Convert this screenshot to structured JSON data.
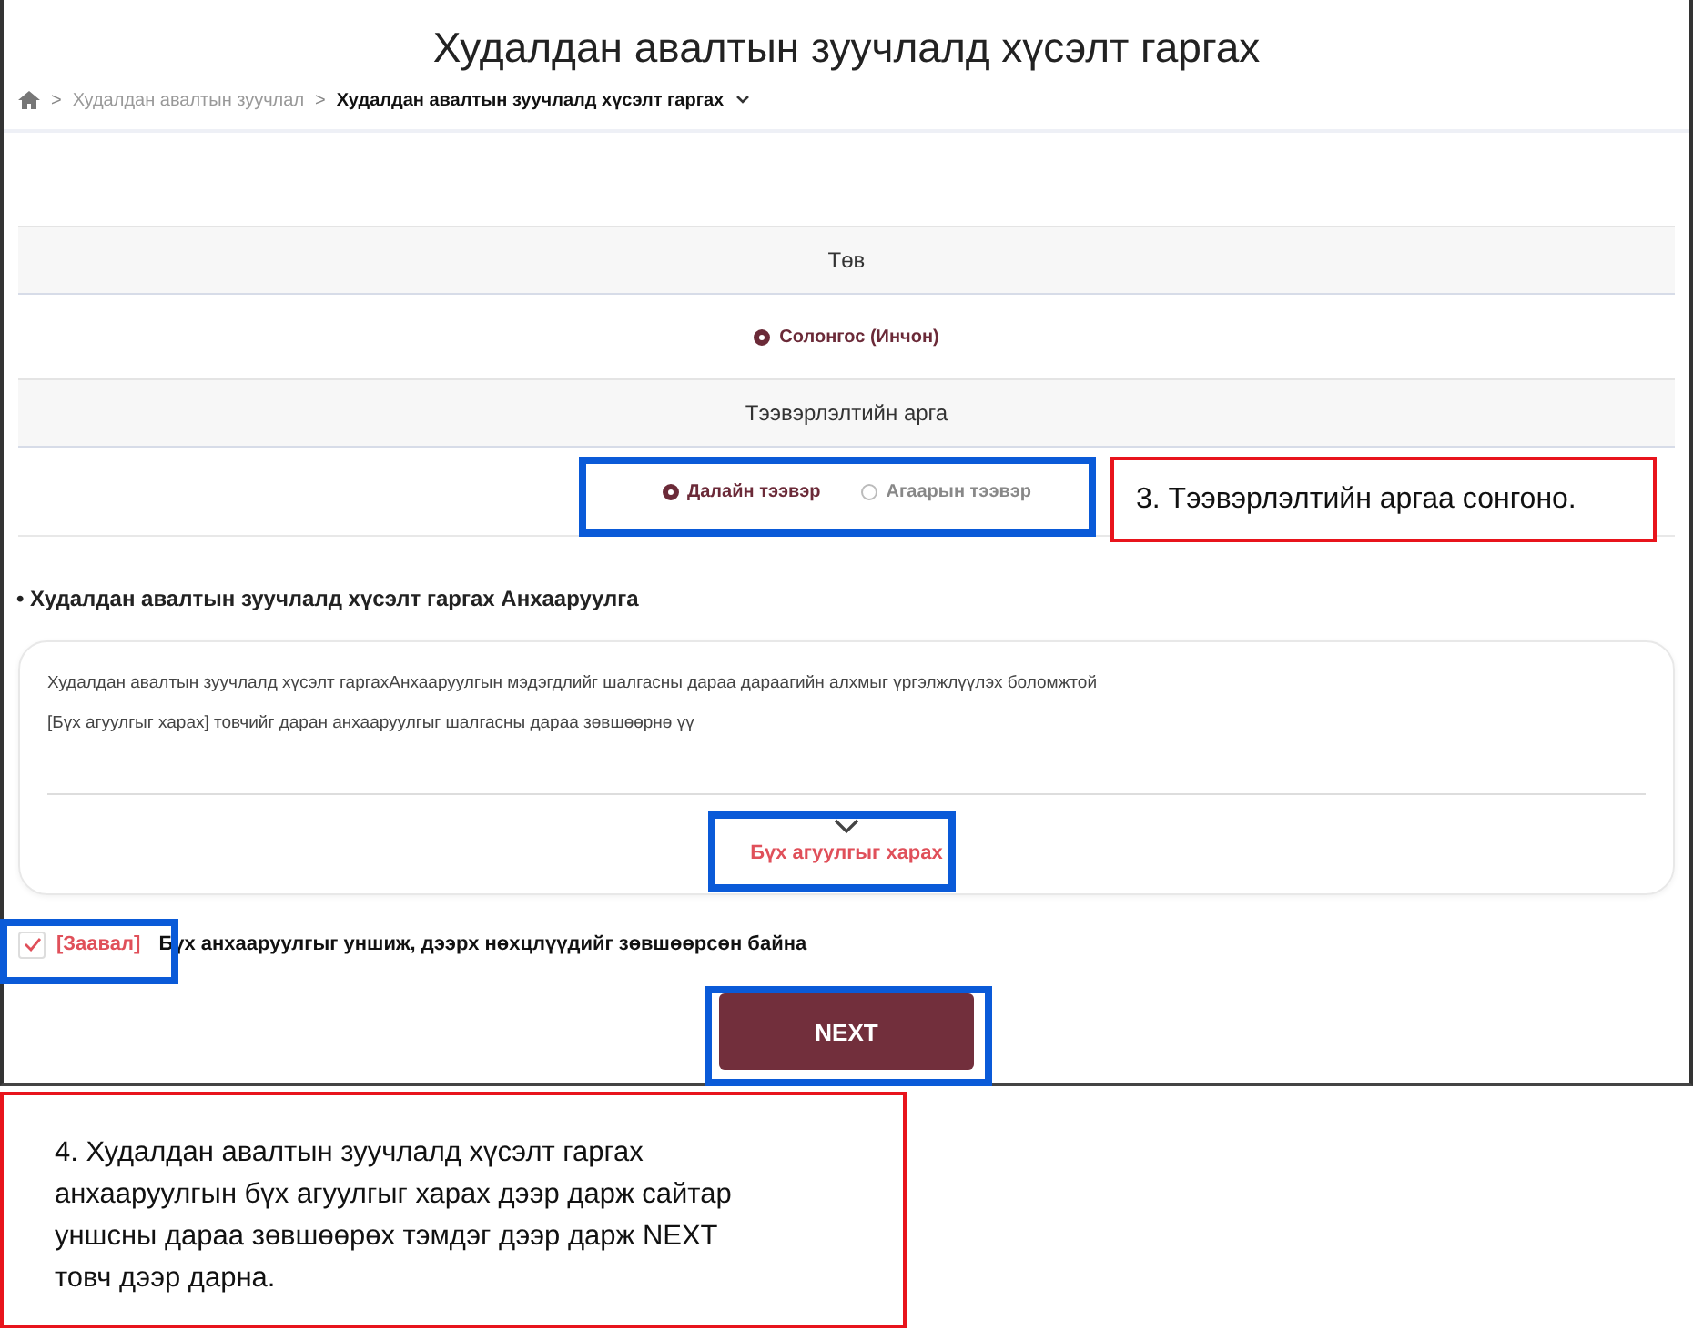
{
  "page": {
    "title": "Худалдан авалтын зуучлалд хүсэлт гаргах"
  },
  "breadcrumb": {
    "separator": ">",
    "items": [
      "Худалдан авалтын зуучлал",
      "Худалдан авалтын зуучлалд хүсэлт гаргах"
    ]
  },
  "sections": [
    {
      "header": "Төв",
      "options": [
        {
          "label": "Солонгос (Инчон)",
          "selected": true
        }
      ]
    },
    {
      "header": "Тээвэрлэлтийн арга",
      "options": [
        {
          "label": "Далайн тээвэр",
          "selected": true
        },
        {
          "label": "Агаарын тээвэр",
          "selected": false
        }
      ]
    }
  ],
  "notice": {
    "title": "• Худалдан авалтын зуучлалд хүсэлт гаргах Анхааруулга",
    "lines": [
      "Худалдан авалтын зуучлалд хүсэлт гаргахАнхааруулгын мэдэгдлийг шалгасны дараа дараагийн алхмыг үргэлжлүүлэх боломжтой",
      "[Бүх агуулгыг харах] товчийг даран анхааруулгыг шалгасны дараа зөвшөөрнө үү"
    ],
    "expand_label": "Бүх агуулгыг харах"
  },
  "agreement": {
    "required": "[Заавал]",
    "text": "Бүх анхааруулгыг уншиж, дээрх нөхцлүүдийг зөвшөөрсөн байна",
    "checked": true
  },
  "next_button": "NEXT",
  "callouts": [
    "3. Тээвэрлэлтийн аргаа сонгоно.",
    "4. Худалдан авалтын зуучлалд хүсэлт гаргах анхааруулгын бүх агуулгыг харах дээр дарж сайтар уншсны дараа зөвшөөрөх тэмдэг дээр дарж NEXT товч дээр дарна."
  ]
}
